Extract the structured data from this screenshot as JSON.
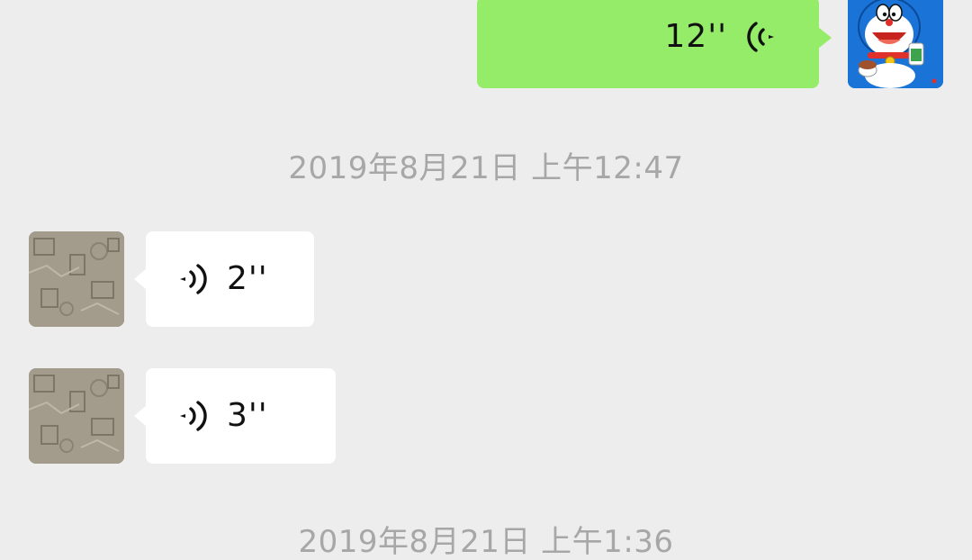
{
  "messages": [
    {
      "direction": "sent",
      "type": "voice",
      "duration": "12''"
    },
    {
      "direction": "received",
      "type": "voice",
      "duration": "2''"
    },
    {
      "direction": "received",
      "type": "voice",
      "duration": "3''"
    }
  ],
  "timestamps": [
    "2019年8月21日 上午12:47",
    "2019年8月21日 上午1:36"
  ],
  "icons": {
    "voice": "voice-wave-icon",
    "avatar_self": "doraemon-avatar",
    "avatar_other": "photo-avatar"
  },
  "colors": {
    "background": "#ededed",
    "sent_bubble": "#95ec69",
    "received_bubble": "#ffffff",
    "timestamp_text": "#a7a7a7",
    "message_text": "#111111"
  }
}
